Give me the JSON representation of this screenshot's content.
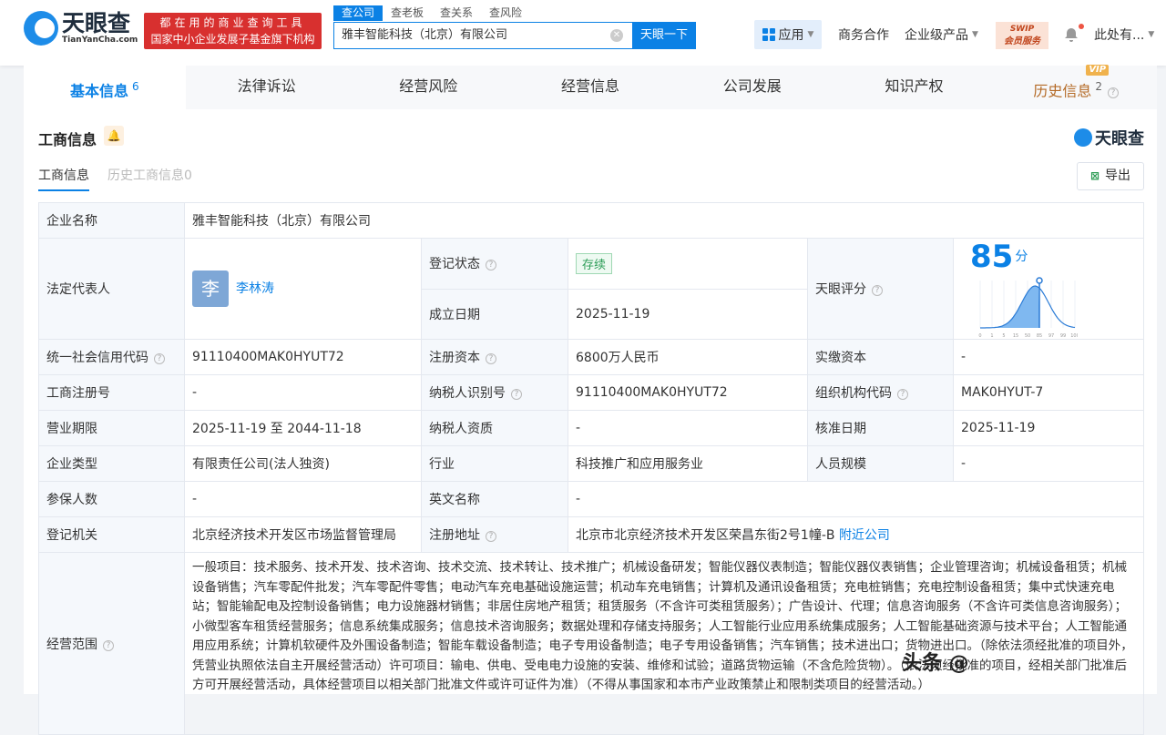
{
  "header": {
    "logo_cn": "天眼查",
    "logo_en": "TianYanCha.com",
    "slogan_1": "都在用的商业查询工具",
    "slogan_2": "国家中小企业发展子基金旗下机构",
    "search_tabs": [
      "查公司",
      "查老板",
      "查关系",
      "查风险"
    ],
    "search_value": "雅丰智能科技（北京）有限公司",
    "search_button": "天眼一下",
    "nav": {
      "apps": "应用",
      "business": "商务合作",
      "enterprise": "企业级产品",
      "swip_1": "SWIP",
      "swip_2": "会员服务",
      "user": "此处有..."
    }
  },
  "tabs": [
    {
      "label": "基本信息",
      "count": "6"
    },
    {
      "label": "法律诉讼"
    },
    {
      "label": "经营风险"
    },
    {
      "label": "经营信息"
    },
    {
      "label": "公司发展"
    },
    {
      "label": "知识产权"
    },
    {
      "label": "历史信息",
      "count": "2",
      "badge": "VIP"
    }
  ],
  "section": {
    "title": "工商信息",
    "brand": "天眼查",
    "subtabs": [
      "工商信息",
      "历史工商信息0"
    ],
    "export": "导出"
  },
  "info": {
    "company_name_label": "企业名称",
    "company_name": "雅丰智能科技（北京）有限公司",
    "legal_rep_label": "法定代表人",
    "legal_rep_avatar": "李",
    "legal_rep": "李林涛",
    "reg_status_label": "登记状态",
    "reg_status": "存续",
    "founded_label": "成立日期",
    "founded": "2025-11-19",
    "score_label": "天眼评分",
    "score": "85",
    "score_unit": "分",
    "score_axis": [
      "0",
      "1",
      "5",
      "15",
      "50",
      "85",
      "97",
      "99",
      "100"
    ],
    "credit_code_label": "统一社会信用代码",
    "credit_code": "91110400MAK0HYUT72",
    "reg_capital_label": "注册资本",
    "reg_capital": "6800万人民币",
    "paid_capital_label": "实缴资本",
    "paid_capital": "-",
    "reg_no_label": "工商注册号",
    "reg_no": "-",
    "taxpayer_id_label": "纳税人识别号",
    "taxpayer_id": "91110400MAK0HYUT72",
    "org_code_label": "组织机构代码",
    "org_code": "MAK0HYUT-7",
    "term_label": "营业期限",
    "term": "2025-11-19 至 2044-11-18",
    "taxpayer_qual_label": "纳税人资质",
    "taxpayer_qual": "-",
    "approve_label": "核准日期",
    "approve": "2025-11-19",
    "type_label": "企业类型",
    "type": "有限责任公司(法人独资)",
    "industry_label": "行业",
    "industry": "科技推广和应用服务业",
    "staff_label": "人员规模",
    "staff": "-",
    "insured_label": "参保人数",
    "insured": "-",
    "en_name_label": "英文名称",
    "en_name": "-",
    "authority_label": "登记机关",
    "authority": "北京经济技术开发区市场监督管理局",
    "address_label": "注册地址",
    "address": "北京市北京经济技术开发区荣昌东街2号1幢-B",
    "nearby": "附近公司",
    "scope_label": "经营范围",
    "scope": "一般项目：技术服务、技术开发、技术咨询、技术交流、技术转让、技术推广；机械设备研发；智能仪器仪表制造；智能仪器仪表销售；企业管理咨询；机械设备租赁；机械设备销售；汽车零配件批发；汽车零配件零售；电动汽车充电基础设施运营；机动车充电销售；计算机及通讯设备租赁；充电桩销售；充电控制设备租赁；集中式快速充电站；智能输配电及控制设备销售；电力设施器材销售；非居住房地产租赁；租赁服务（不含许可类租赁服务）；广告设计、代理；信息咨询服务（不含许可类信息咨询服务）；小微型客车租赁经营服务；信息系统集成服务；信息技术咨询服务；数据处理和存储支持服务；人工智能行业应用系统集成服务；人工智能基础资源与技术平台；人工智能通用应用系统；计算机软硬件及外围设备制造；智能车载设备制造；电子专用设备制造；电子专用设备销售；汽车销售；技术进出口；货物进出口。（除依法须经批准的项目外，凭营业执照依法自主开展经营活动）许可项目：输电、供电、受电电力设施的安装、维修和试验；道路货物运输（不含危险货物）。（依法须经批准的项目，经相关部门批准后方可开展经营活动，具体经营项目以相关部门批准文件或许可证件为准）（不得从事国家和本市产业政策禁止和限制类项目的经营活动。）"
  },
  "watermark": "头条 @"
}
